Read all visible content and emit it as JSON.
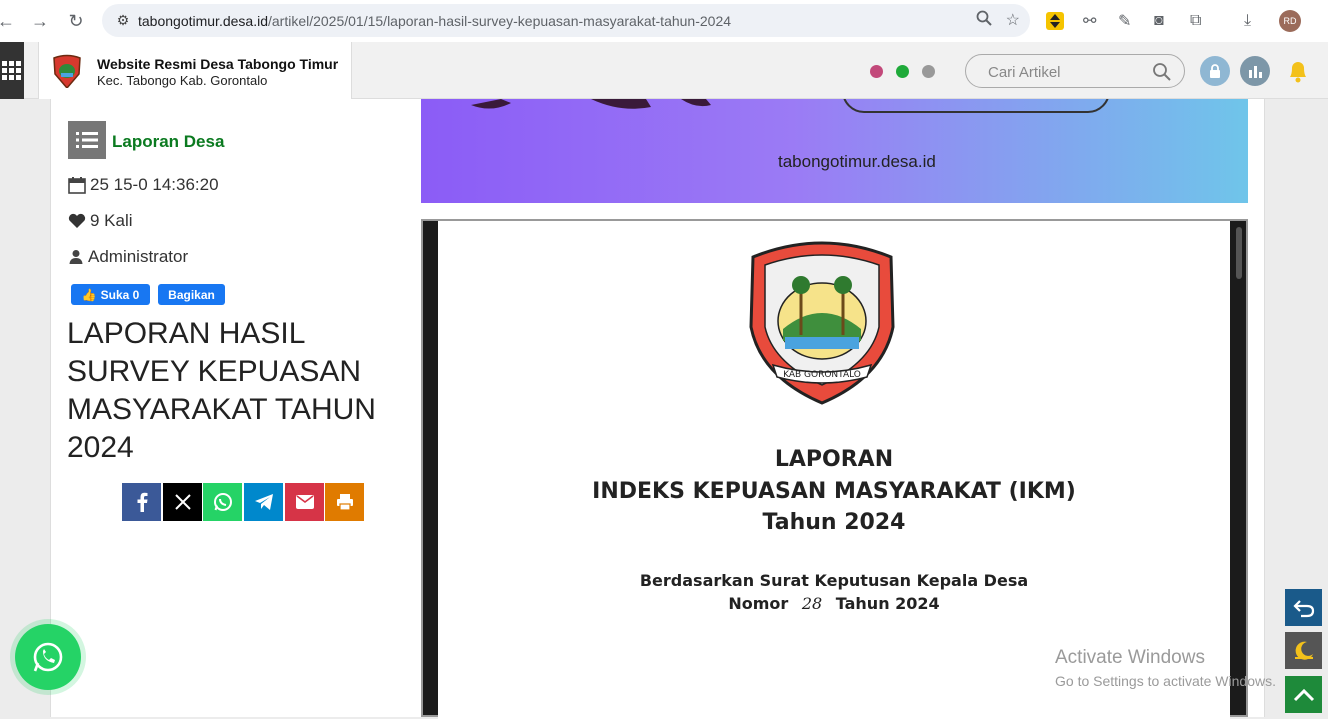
{
  "browser": {
    "url_domain": "tabongotimur.desa.id",
    "url_path": "/artikel/2025/01/15/laporan-hasil-survey-kepuasan-masyarakat-tahun-2024",
    "avatar_initials": "RD"
  },
  "header": {
    "site_title": "Website Resmi Desa Tabongo Timur",
    "site_subtitle": "Kec. Tabongo Kab. Gorontalo",
    "search_placeholder": "Cari Artikel",
    "dot_colors": [
      "#c2497a",
      "#1faa3a",
      "#999999"
    ]
  },
  "article": {
    "category": "Laporan Desa",
    "date": "25 15-0 14:36:20",
    "views": "9 Kali",
    "author": "Administrator",
    "fb_like": "Suka 0",
    "fb_share": "Bagikan",
    "title": "LAPORAN HASIL SURVEY KEPUASAN MASYARAKAT TAHUN 2024"
  },
  "banner": {
    "url_text": "tabongotimur.desa.id"
  },
  "document": {
    "logo_text": "KAB GORONTALO",
    "line1": "LAPORAN",
    "line2": "INDEKS KEPUASAN MASYARAKAT (IKM)",
    "line3": "Tahun 2024",
    "line4": "Berdasarkan Surat Keputusan Kepala Desa",
    "line5_prefix": "Nomor",
    "line5_number": "28",
    "line5_suffix": "Tahun 2024"
  },
  "watermark": {
    "title": "Activate Windows",
    "subtitle": "Go to Settings to activate Windows."
  },
  "colors": {
    "category_green": "#0b7a20",
    "facebook": "#3b5998",
    "x": "#000000",
    "whatsapp": "#25d366",
    "telegram": "#0088cc",
    "email": "#d63447",
    "print": "#e07b00"
  }
}
